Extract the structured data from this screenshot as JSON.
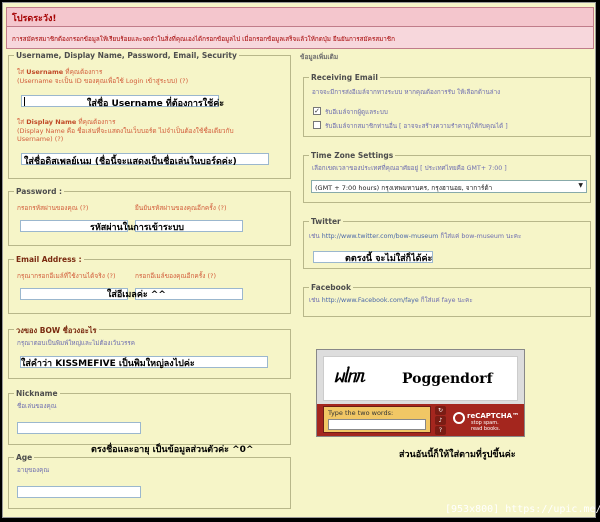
{
  "alert": {
    "title": "โปรดระวัง!",
    "message": "การสมัครสมาชิกต้องกรอกข้อมูลให้เรียบร้อยและจดจำในสิ่งที่คุณเองได้กรอกข้อมูลไป เมื่อกรอกข้อมูลเสร็จแล้วให้กดปุ่ม ยืนยันการสมัครสมาชิก"
  },
  "account": {
    "legend": "Username, Display Name, Password, Email, Security",
    "username_label_prefix": "ใส่",
    "username_label_bold": "Username",
    "username_label_suffix": "ที่คุณต้องการ",
    "username_hint": "(Username จะเป็น ID ของคุณเพื่อใช้ Login เข้าสู่ระบบ)",
    "username_help": "(?)",
    "username_overlay": "ใส่ชื่อ Username ที่ต้องการใช้ค่ะ",
    "display_label_prefix": "ใส่",
    "display_label_bold": "Display Name",
    "display_label_suffix": "ที่คุณต้องการ",
    "display_hint_1": "(Display Name คือ ชื่อเล่นที่จะแสดงในเว็บบอร์ด ไม่จำเป็นต้องใช้ชื่อเดียวกับ",
    "display_hint_2": "Username)",
    "display_help": "(?)",
    "display_overlay": "ใส่ชื่อดิสเพลย์เนม (ชื่อนี้จะแสดงเป็นชื่อเล่นในบอร์ดค่ะ)"
  },
  "password": {
    "legend": "Password :",
    "label_1": "กรอกรหัสผ่านของคุณ",
    "label_2": "ยืนยันรหัสผ่านของคุณอีกครั้ง",
    "help": "(?)",
    "overlay": "รหัสผ่านในการเข้าระบบ"
  },
  "email": {
    "legend": "Email Address :",
    "label_1": "กรุณากรอกอีเมล์ที่ใช้งานได้จริง",
    "label_2": "กรอกอีเมล์ของคุณอีกครั้ง",
    "help": "(?)",
    "overlay": "ใส่อีเมลค่ะ ^^"
  },
  "security": {
    "legend": "วงของ BOW ชื่อวงอะไร",
    "hint": "กรุณาตอบเป็นพิมพ์ใหญ่และไม่ต้องเว้นวรรค",
    "overlay": "ใส่คำว่า KISSMEFIVE เป็นพิมใหญ่ลงไปค่ะ"
  },
  "nickname": {
    "legend": "Nickname",
    "hint": "ชื่อเล่นของคุณ"
  },
  "age": {
    "legend": "Age",
    "hint": "อายุของคุณ"
  },
  "personal_note": "ตรงชื่อและอายุ เป็นข้อมูลส่วนตัวค่ะ ^0^",
  "extra": {
    "title": "ข้อมูลเพิ่มเติม"
  },
  "receiving_email": {
    "legend": "Receiving Email",
    "hint": "อาจจะมีการส่งอีเมล์จากทางระบบ หากคุณต้องการรับ ให้เลือกด้านล่าง",
    "option_1": "รับอีเมล์จากผู้ดูแลระบบ",
    "option_1_checked": true,
    "option_2": "รับอีเมล์จากสมาชิกท่านอื่น [ อาจจะสร้างความรำคาญให้กับคุณได้ ]",
    "option_2_checked": false
  },
  "timezone": {
    "legend": "Time Zone Settings",
    "hint": "เลือกเขตเวลาของประเทศที่คุณอาศัยอยู่ [ ประเทศไทยคือ GMT+ 7:00 ]",
    "selected": "(GMT + 7:00 hours) กรุงเทพมหานคร, กรุงฮานอย, จาการ์ต้า"
  },
  "twitter": {
    "legend": "Twitter",
    "hint_prefix": "เช่น",
    "hint_url": "http://www.twitter.com/bow-museum",
    "hint_suffix": "ก็ใส่แค่ bow-museum นะคะ",
    "overlay": "ตตรงนี้ จะไม่ใส่ก็ได้ค่ะ"
  },
  "facebook": {
    "legend": "Facebook",
    "hint_prefix": "เช่น",
    "hint_url": "http://www.Facebook.com/faye",
    "hint_suffix": "ก็ใส่แค่ faye นะคะ"
  },
  "captcha": {
    "text": "Poggendorf",
    "squiggle": "ᥕᥣᥒᥰ",
    "prompt": "Type the two words:",
    "brand": "reCAPTCHA™",
    "tagline_1": "stop spam.",
    "tagline_2": "read books.",
    "note": "ส่วนอันนี้ก็ให้ใส่ตามที่รูปขึ้นค่ะ"
  },
  "watermark": "[953x800] https://upic.me/"
}
